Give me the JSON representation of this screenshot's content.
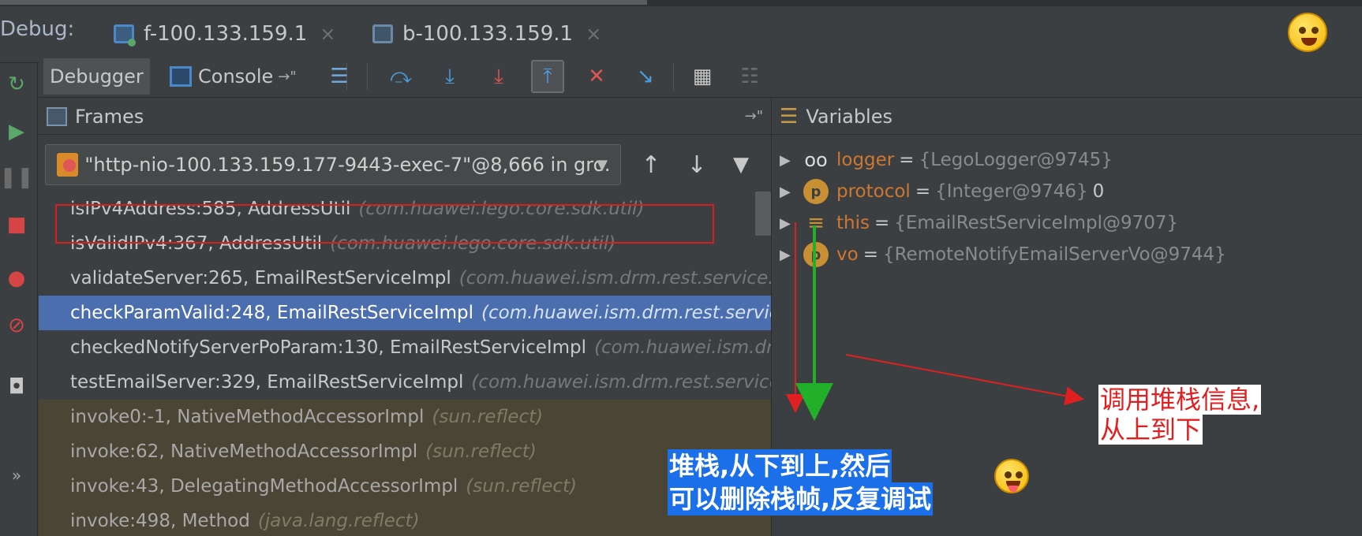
{
  "debug_tabs": {
    "label": "Debug:",
    "sessions": [
      {
        "name": "f-100.133.159.1",
        "close": "×"
      },
      {
        "name": "b-100.133.159.1",
        "close": "×"
      }
    ]
  },
  "toolbar": {
    "debugger_tab": "Debugger",
    "console_tab": "Console",
    "pin_icon": "→\""
  },
  "frames": {
    "title": "Frames",
    "pin_icon": "→\"",
    "thread": "\"http-nio-100.133.159.177-9443-exec-7\"@8,666 in gro...",
    "dropdown_arrow": "▼",
    "up": "↑",
    "down": "↓",
    "filter": "▼",
    "rows": [
      {
        "method": "isIPv4Address:585, AddressUtil",
        "pkg": "(com.huawei.lego.core.sdk.util)",
        "state": "normal"
      },
      {
        "method": "isValidIPv4:367, AddressUtil",
        "pkg": "(com.huawei.lego.core.sdk.util)",
        "state": "normal"
      },
      {
        "method": "validateServer:265, EmailRestServiceImpl",
        "pkg": "(com.huawei.ism.drm.rest.service.frame",
        "state": "normal"
      },
      {
        "method": "checkParamValid:248, EmailRestServiceImpl",
        "pkg": "(com.huawei.ism.drm.rest.service.fra",
        "state": "selected"
      },
      {
        "method": "checkedNotifyServerPoParam:130, EmailRestServiceImpl",
        "pkg": "(com.huawei.ism.drm.r",
        "state": "normal"
      },
      {
        "method": "testEmailServer:329, EmailRestServiceImpl",
        "pkg": "(com.huawei.ism.drm.rest.service.fram",
        "state": "normal"
      },
      {
        "method": "invoke0:-1, NativeMethodAccessorImpl",
        "pkg": "(sun.reflect)",
        "state": "library"
      },
      {
        "method": "invoke:62, NativeMethodAccessorImpl",
        "pkg": "(sun.reflect)",
        "state": "library"
      },
      {
        "method": "invoke:43, DelegatingMethodAccessorImpl",
        "pkg": "(sun.reflect)",
        "state": "library"
      },
      {
        "method": "invoke:498, Method",
        "pkg": "(java.lang.reflect)",
        "state": "library"
      }
    ]
  },
  "variables": {
    "title": "Variables",
    "rows": [
      {
        "icon": "oo",
        "name": "logger",
        "eq": "=",
        "value": "{LegoLogger@9745}",
        "extra": ""
      },
      {
        "icon": "p",
        "name": "protocol",
        "eq": "=",
        "value": "{Integer@9746}",
        "extra": "0"
      },
      {
        "icon": "≡",
        "name": "this",
        "eq": "=",
        "value": "{EmailRestServiceImpl@9707}",
        "extra": ""
      },
      {
        "icon": "p",
        "name": "vo",
        "eq": "=",
        "value": "{RemoteNotifyEmailServerVo@9744}",
        "extra": ""
      }
    ],
    "expand_icon": "▶"
  },
  "annotations": {
    "call_stack_line1": "调用堆栈信息,",
    "call_stack_line2": "从上到下",
    "stack_line1": "堆栈,从下到上,然后",
    "stack_line2": "可以删除栈帧,反复调试"
  },
  "sidebar": {
    "more": "»"
  },
  "colors": {
    "background": "#3c3f41",
    "selection": "#4b6eaf",
    "library_row": "#4a4535",
    "annotation_red": "#e02020",
    "annotation_green": "#22b02a",
    "annotation_blue": "#1b6fe8"
  }
}
